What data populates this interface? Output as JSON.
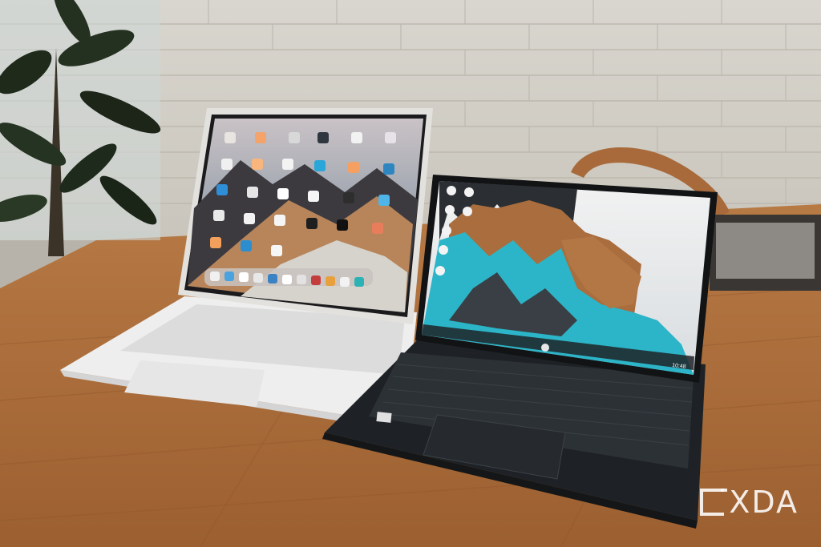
{
  "image": {
    "description_free": true
  },
  "watermark": {
    "text": "XDA"
  },
  "ipad_screen": {
    "dock_icon_count": 11
  },
  "samsung_screen": {
    "taskbar_time": "10:48"
  }
}
